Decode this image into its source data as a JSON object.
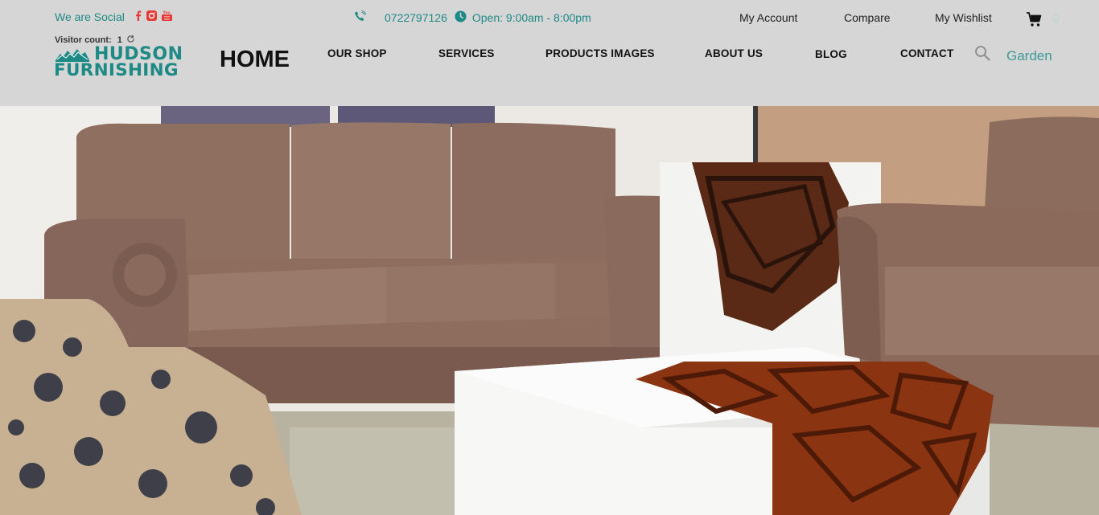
{
  "social": {
    "label": "We are Social",
    "icons": [
      "facebook-icon",
      "instagram-icon",
      "youtube-icon"
    ],
    "icon_color": "#e53935"
  },
  "visitor": {
    "label": "Visitor count:",
    "count": "1"
  },
  "logo": {
    "line1": "HUDSON",
    "line2": "FURNISHING",
    "color": "#1d8a86"
  },
  "page_title": "HOME",
  "contact": {
    "phone": "0722797126",
    "hours": "Open: 9:00am - 8:00pm"
  },
  "top_links": {
    "account": "My Account",
    "compare": "Compare",
    "wishlist": "My Wishlist"
  },
  "nav": {
    "shop": "OUR SHOP",
    "services": "SERVICES",
    "products_images": "PRODUCTS IMAGES",
    "about": "ABOUT US",
    "blog": "BLOG",
    "contact": "CONTACT"
  },
  "location": "Garden",
  "colors": {
    "accent": "#1d8a86",
    "header_bg": "#d6d6d6"
  }
}
